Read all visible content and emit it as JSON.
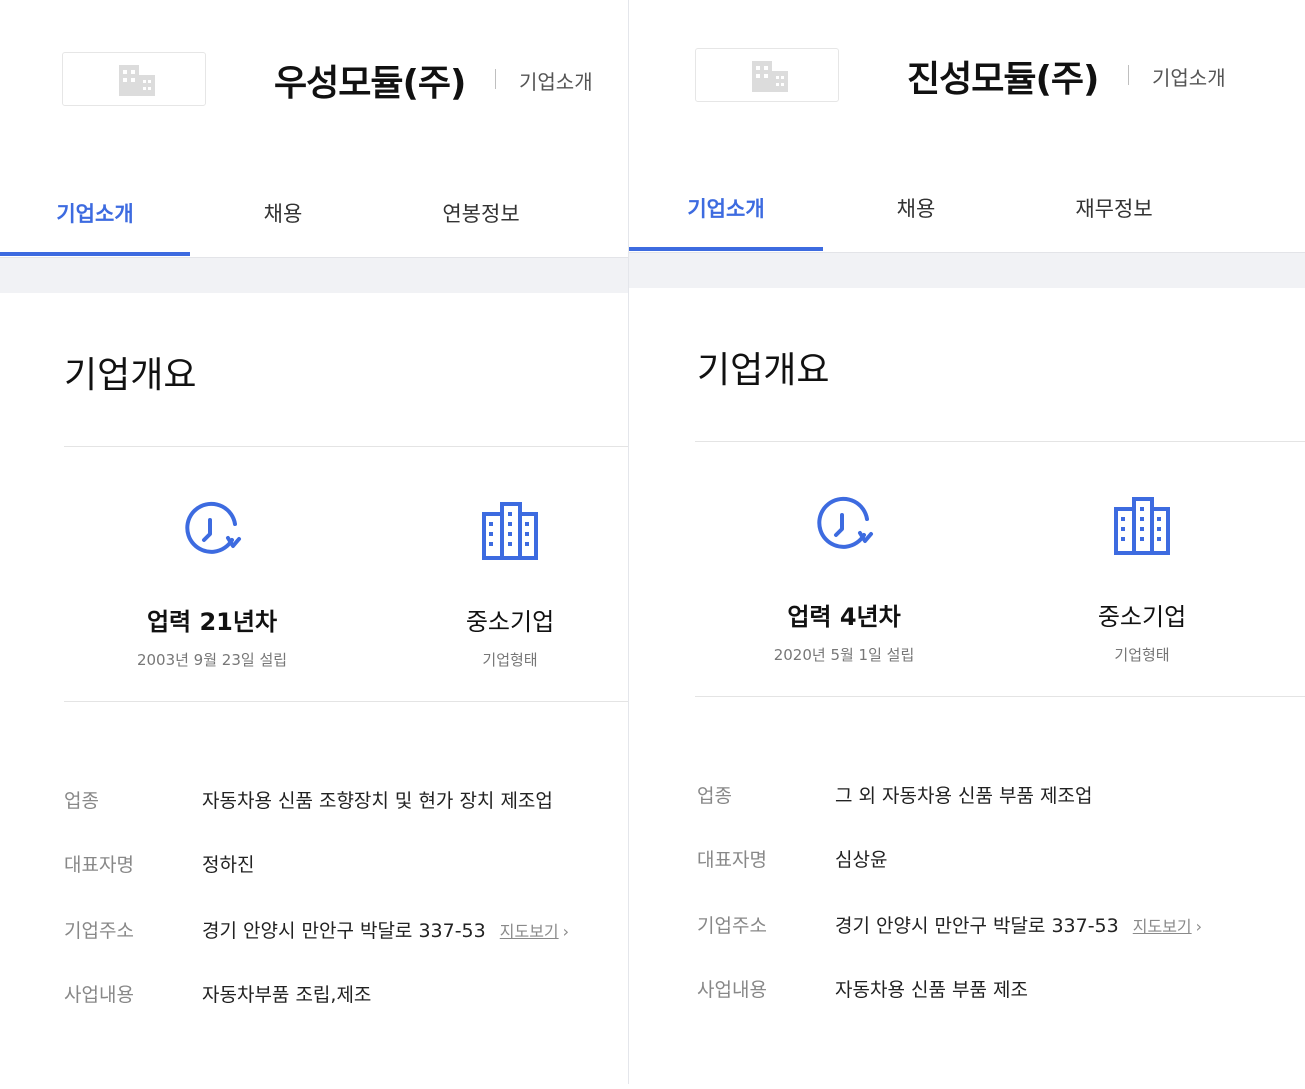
{
  "accent_color": "#3d6be0",
  "panels": [
    {
      "company_name": "우성모듈(주)",
      "header_sub": "기업소개",
      "tabs": [
        {
          "label": "기업소개",
          "active": true
        },
        {
          "label": "채용",
          "active": false
        },
        {
          "label": "연봉정보",
          "active": false
        }
      ],
      "section_title": "기업개요",
      "stats": [
        {
          "icon": "clock-icon",
          "main": "업력 21년차",
          "sub": "2003년 9월 23일 설립"
        },
        {
          "icon": "building-icon",
          "main": "중소기업",
          "sub": "기업형태"
        }
      ],
      "info": [
        {
          "label": "업종",
          "value": "자동차용 신품 조향장치 및 현가 장치 제조업"
        },
        {
          "label": "대표자명",
          "value": "정하진"
        },
        {
          "label": "기업주소",
          "value": "경기 안양시 만안구 박달로 337-53",
          "link": "지도보기",
          "link_chevron": "›"
        },
        {
          "label": "사업내용",
          "value": "자동차부품 조립,제조"
        }
      ]
    },
    {
      "company_name": "진성모듈(주)",
      "header_sub": "기업소개",
      "tabs": [
        {
          "label": "기업소개",
          "active": true
        },
        {
          "label": "채용",
          "active": false
        },
        {
          "label": "재무정보",
          "active": false
        }
      ],
      "section_title": "기업개요",
      "stats": [
        {
          "icon": "clock-icon",
          "main": "업력 4년차",
          "sub": "2020년 5월 1일 설립"
        },
        {
          "icon": "building-icon",
          "main": "중소기업",
          "sub": "기업형태"
        }
      ],
      "info": [
        {
          "label": "업종",
          "value": "그 외 자동차용 신품 부품 제조업"
        },
        {
          "label": "대표자명",
          "value": "심상윤"
        },
        {
          "label": "기업주소",
          "value": "경기 안양시 만안구 박달로 337-53",
          "link": "지도보기",
          "link_chevron": "›"
        },
        {
          "label": "사업내용",
          "value": "자동차용 신품 부품 제조"
        }
      ]
    }
  ]
}
